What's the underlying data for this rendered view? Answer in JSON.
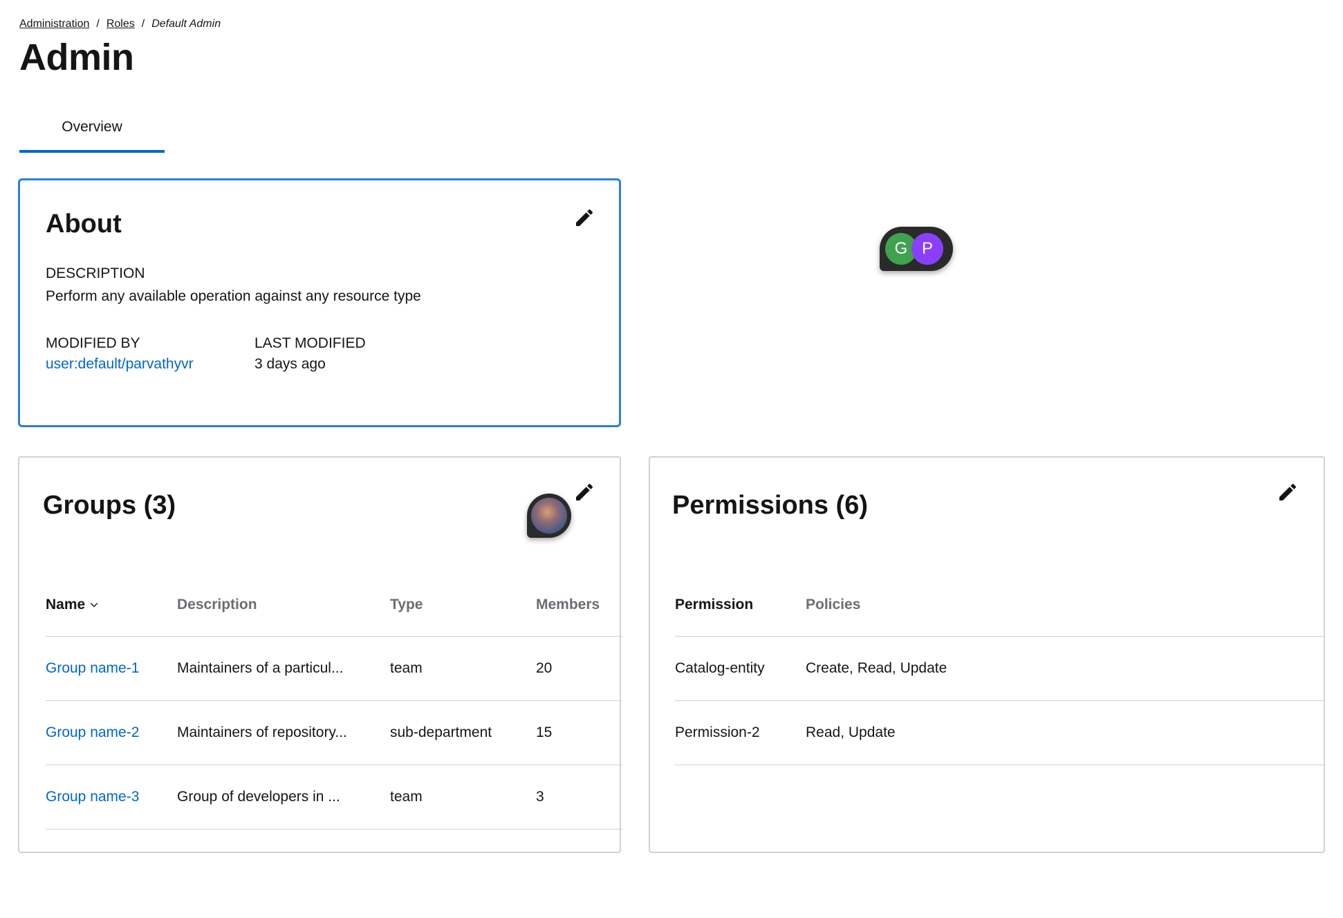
{
  "breadcrumb": {
    "items": [
      "Administration",
      "Roles"
    ],
    "current": "Default Admin",
    "separator": "/"
  },
  "page_title": "Admin",
  "tabs": [
    {
      "label": "Overview",
      "active": true
    }
  ],
  "about": {
    "title": "About",
    "description_label": "DESCRIPTION",
    "description": "Perform any available operation against any resource type",
    "modified_by_label": "MODIFIED BY",
    "modified_by": "user:default/parvathyvr",
    "last_modified_label": "LAST MODIFIED",
    "last_modified": "3 days ago"
  },
  "groups": {
    "title": "Groups (3)",
    "columns": [
      "Name",
      "Description",
      "Type",
      "Members"
    ],
    "rows": [
      {
        "name": "Group name-1",
        "description": "Maintainers of a particul...",
        "type": "team",
        "members": "20"
      },
      {
        "name": "Group name-2",
        "description": "Maintainers of repository...",
        "type": "sub-department",
        "members": "15"
      },
      {
        "name": "Group name-3",
        "description": "Group of developers in ...",
        "type": "team",
        "members": "3"
      }
    ]
  },
  "permissions": {
    "title": "Permissions (6)",
    "columns": [
      "Permission",
      "Policies"
    ],
    "rows": [
      {
        "permission": "Catalog-entity",
        "policies": "Create, Read, Update"
      },
      {
        "permission": "Permission-2",
        "policies": "Read, Update"
      }
    ]
  },
  "presence": {
    "avatars": [
      {
        "initial": "G",
        "color": "#3fa34d"
      },
      {
        "initial": "P",
        "color": "#8a3ffc"
      }
    ]
  },
  "icons": {
    "edit": "pencil-icon",
    "sort": "chevron-down-icon"
  },
  "colors": {
    "accent": "#0066cc",
    "focus_border": "#2b7fd6"
  }
}
